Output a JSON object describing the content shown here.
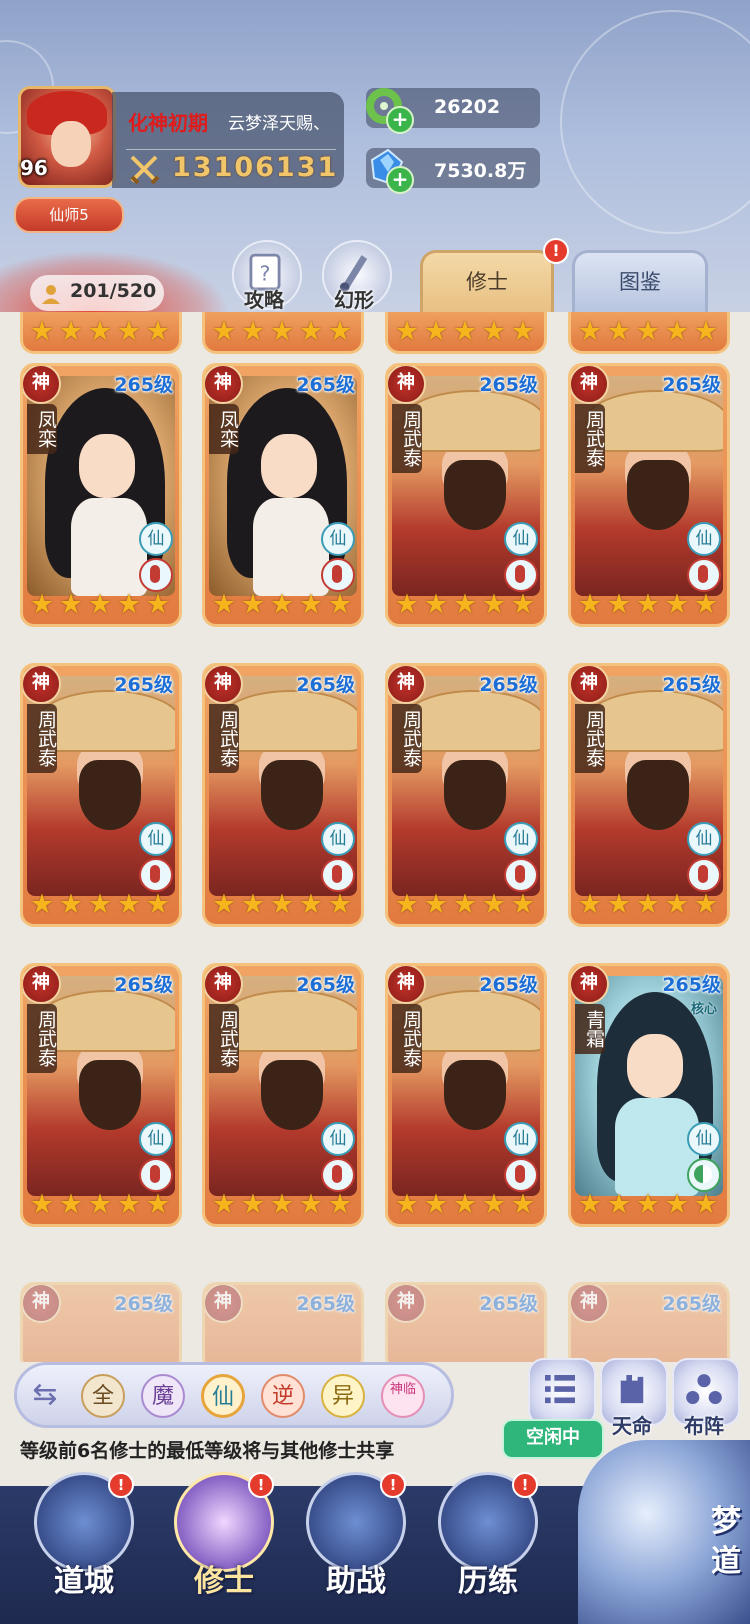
{
  "header": {
    "player_level": "96",
    "realm": "化神初期",
    "title": "云梦泽天赐、",
    "power": "13106131",
    "rank": "仙师5",
    "resource_1": "26202",
    "resource_2": "7530.8万",
    "cultivator_count": "201/520",
    "guide_label": "攻略",
    "transform_label": "幻形",
    "tab_active": "修士",
    "tab_inactive": "图鉴",
    "tab_badge": "!"
  },
  "cards": [
    {
      "grade": "神",
      "level": "265级",
      "name": "凤栾",
      "faction": "仙",
      "style": "phoenix",
      "stars": 5
    },
    {
      "grade": "神",
      "level": "265级",
      "name": "凤栾",
      "faction": "仙",
      "style": "phoenix",
      "stars": 5
    },
    {
      "grade": "神",
      "level": "265级",
      "name": "周武泰",
      "faction": "仙",
      "style": "zhou",
      "stars": 5
    },
    {
      "grade": "神",
      "level": "265级",
      "name": "周武泰",
      "faction": "仙",
      "style": "zhou",
      "stars": 5
    },
    {
      "grade": "神",
      "level": "265级",
      "name": "周武泰",
      "faction": "仙",
      "style": "zhou",
      "stars": 5
    },
    {
      "grade": "神",
      "level": "265级",
      "name": "周武泰",
      "faction": "仙",
      "style": "zhou",
      "stars": 5
    },
    {
      "grade": "神",
      "level": "265级",
      "name": "周武泰",
      "faction": "仙",
      "style": "zhou",
      "stars": 5
    },
    {
      "grade": "神",
      "level": "265级",
      "name": "周武泰",
      "faction": "仙",
      "style": "zhou",
      "stars": 5
    },
    {
      "grade": "神",
      "level": "265级",
      "name": "周武泰",
      "faction": "仙",
      "style": "zhou",
      "stars": 5
    },
    {
      "grade": "神",
      "level": "265级",
      "name": "周武泰",
      "faction": "仙",
      "style": "zhou",
      "stars": 5
    },
    {
      "grade": "神",
      "level": "265级",
      "name": "周武泰",
      "faction": "仙",
      "style": "zhou",
      "stars": 5
    },
    {
      "grade": "神",
      "level": "265级",
      "name": "青霜",
      "faction": "仙",
      "style": "qing",
      "core": "核心",
      "stars": 5
    }
  ],
  "partial_row_level": "265级",
  "partial_row_grade": "神",
  "filters": [
    "全",
    "魔",
    "仙",
    "逆",
    "异",
    "神临"
  ],
  "filter_selected": "仙",
  "side_buttons": {
    "tianming": "天命",
    "buzhen": "布阵"
  },
  "notice": "等级前6名修士的最低等级将与其他修士共享",
  "idle": "空闲中",
  "nav": [
    {
      "label": "道城",
      "badge": "!"
    },
    {
      "label": "修士",
      "badge": "!",
      "active": true
    },
    {
      "label": "助战",
      "badge": "!"
    },
    {
      "label": "历练",
      "badge": "!"
    }
  ],
  "dream_label": "梦道"
}
